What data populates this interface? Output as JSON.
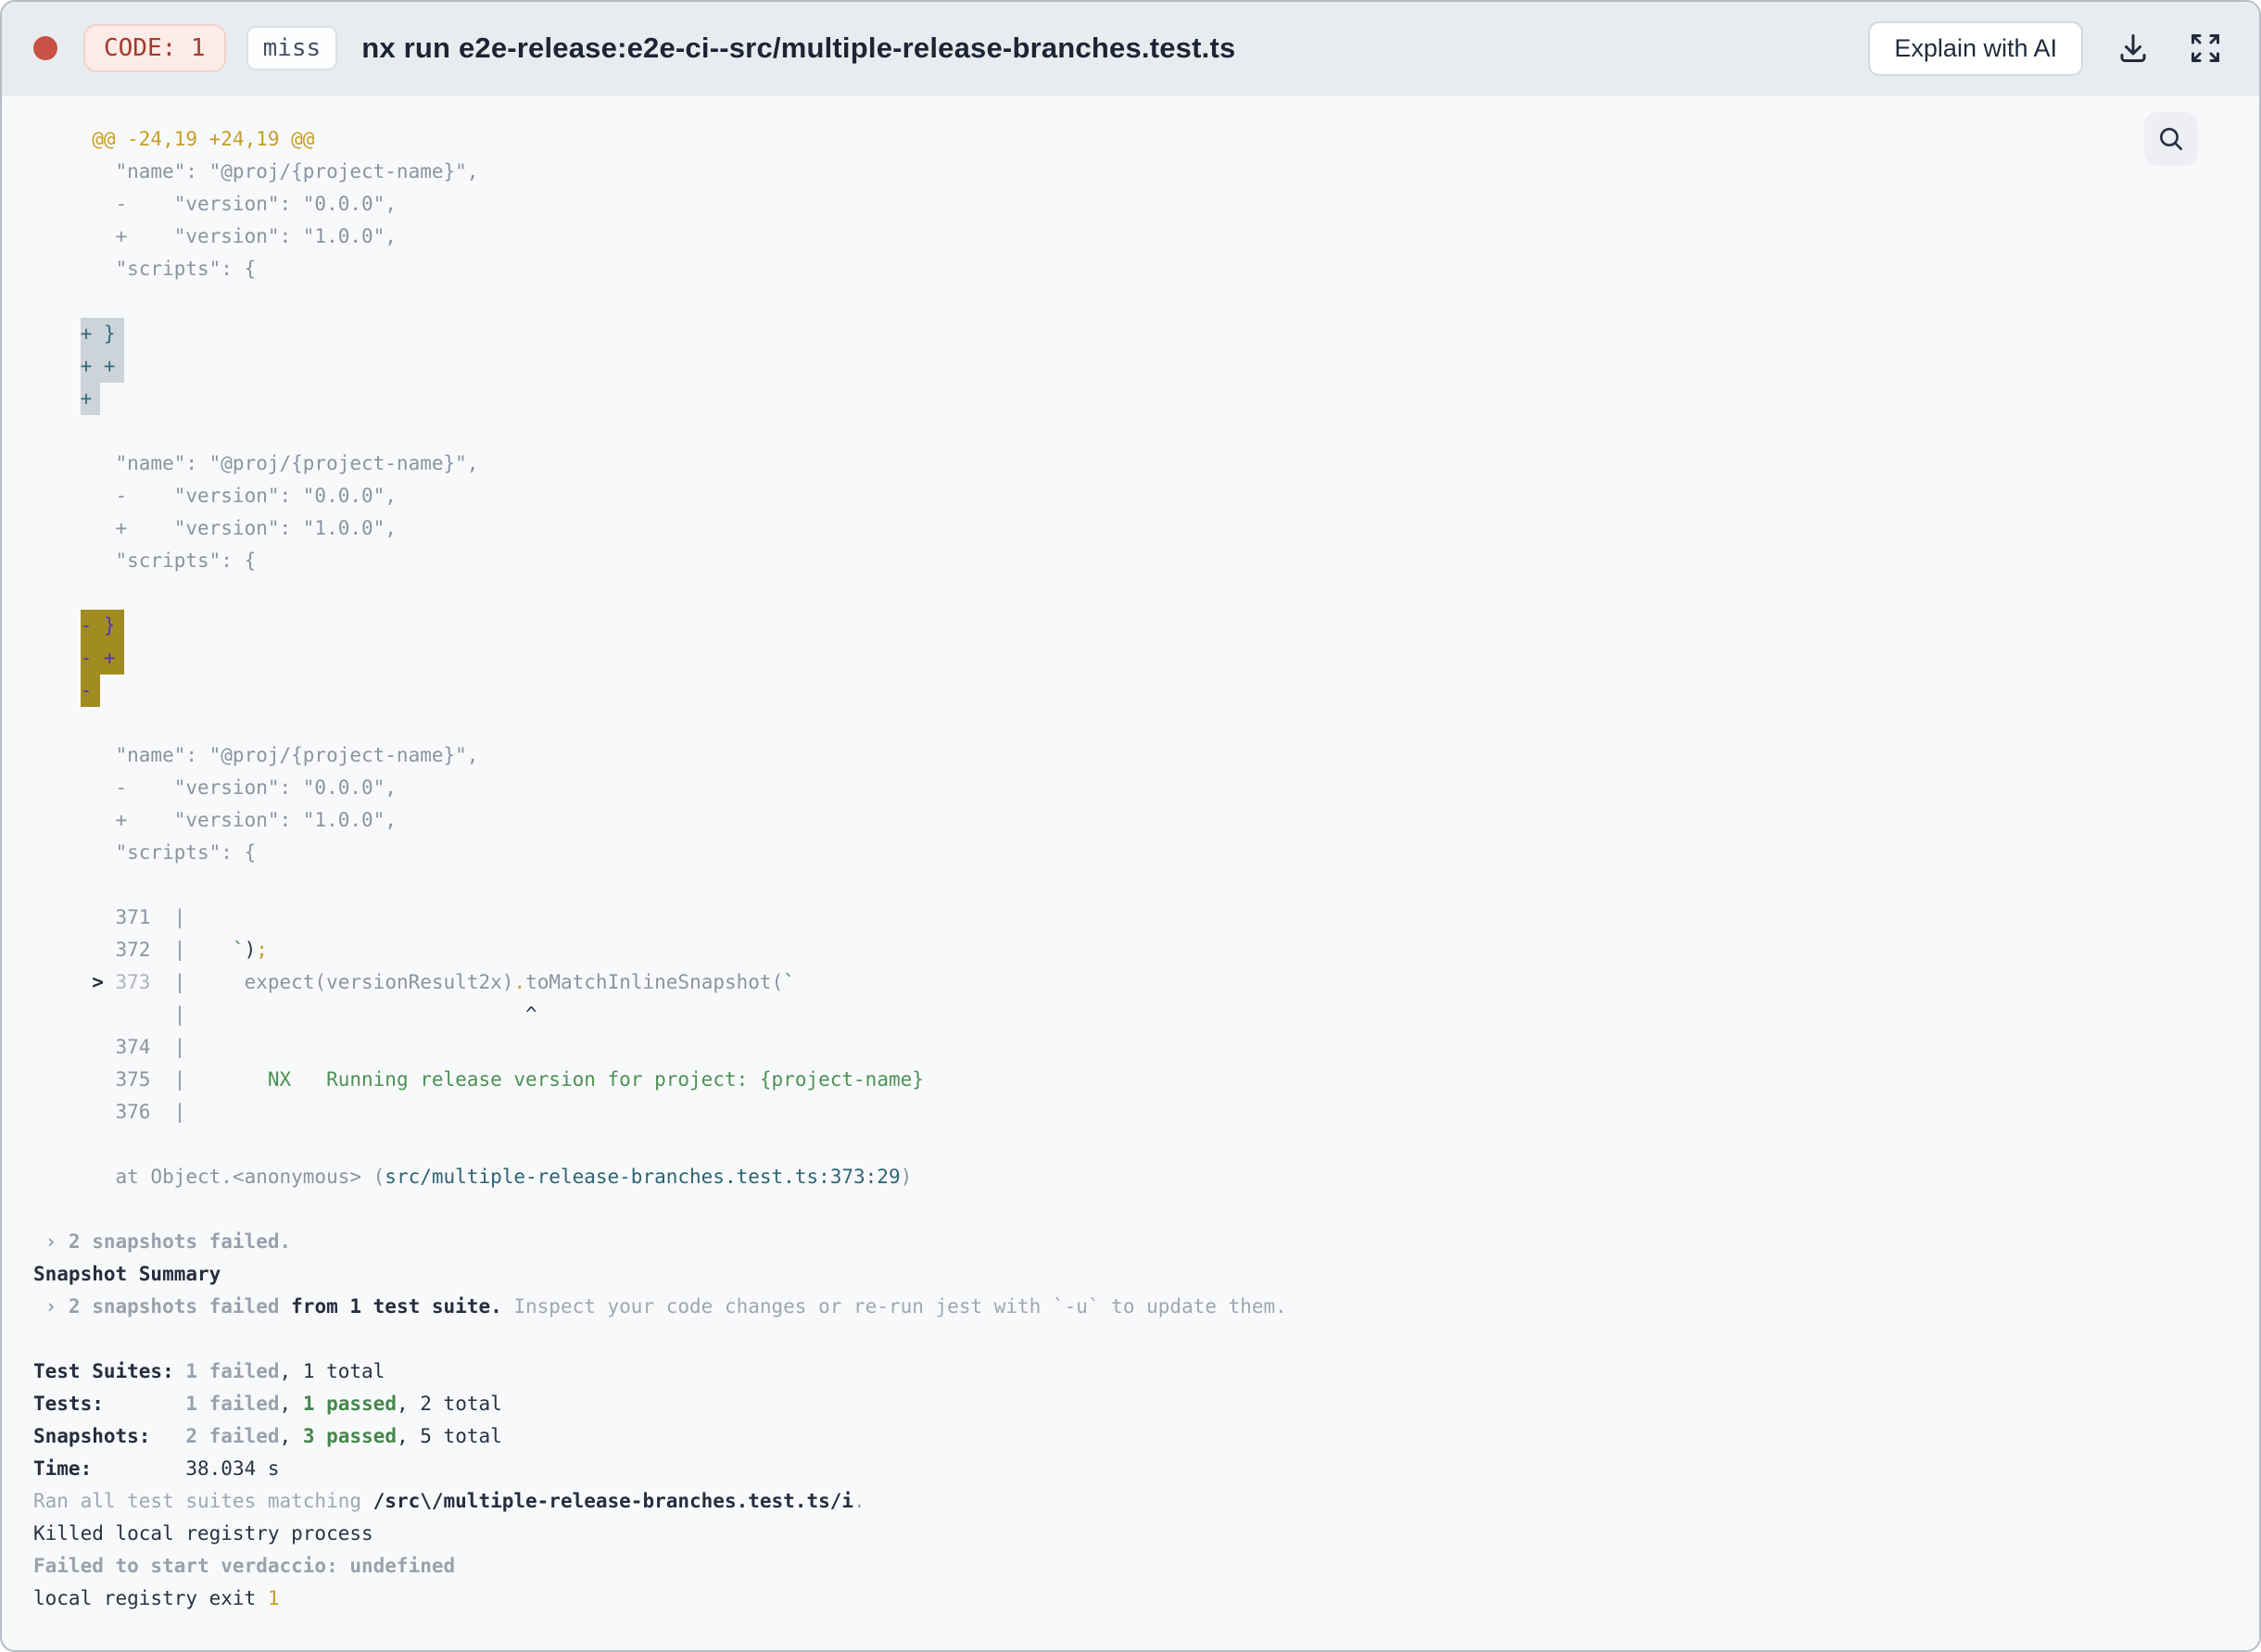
{
  "header": {
    "exit_code_badge": "CODE: 1",
    "cache_status_badge": "miss",
    "title": "nx run e2e-release:e2e-ci--src/multiple-release-branches.test.ts",
    "explain_ai_button": "Explain with AI",
    "icons": {
      "status_dot": "red-status-dot",
      "download_icon": "download-arrow-tray",
      "expand_icon": "fullscreen-corner-arrows",
      "search_icon": "magnifying-glass"
    }
  },
  "colors": {
    "header_bg": "#e8ecf1",
    "terminal_bg": "#f8f9fb",
    "status_red": "#c85045",
    "exit_badge_text": "#a23b2e",
    "exit_badge_bg": "#fcebe7",
    "hunk_yellow": "#c79e23",
    "diff_gray": "#8d939f",
    "success_green": "#4c9153",
    "file_link_teal": "#2d6473",
    "added_highlight_bg": "#ccd3d9",
    "added_highlight_text": "#336b79",
    "removed_highlight_bg": "#a18c20",
    "removed_highlight_text": "#5532b4"
  },
  "terminal": {
    "lines": [
      [
        {
          "t": "     @@ -24,19 +24,19 @@",
          "c": "yellow"
        }
      ],
      [
        {
          "t": "       \"name\": \"@proj/{project-name}\",",
          "c": "ctx"
        }
      ],
      [
        {
          "t": "       -    \"version\": \"0.0.0\",",
          "c": "ctx"
        }
      ],
      [
        {
          "t": "       +    \"version\": \"1.0.0\",",
          "c": "ctx"
        }
      ],
      [
        {
          "t": "       \"scripts\": {",
          "c": "ctx"
        }
      ],
      [],
      [
        {
          "t": "    ",
          "c": "ctx"
        },
        {
          "t": "+ }",
          "c": "add"
        }
      ],
      [
        {
          "t": "    ",
          "c": "ctx"
        },
        {
          "t": "+ +",
          "c": "add"
        }
      ],
      [
        {
          "t": "    ",
          "c": "ctx"
        },
        {
          "t": "+",
          "c": "add"
        }
      ],
      [],
      [
        {
          "t": "       \"name\": \"@proj/{project-name}\",",
          "c": "ctx"
        }
      ],
      [
        {
          "t": "       -    \"version\": \"0.0.0\",",
          "c": "ctx"
        }
      ],
      [
        {
          "t": "       +    \"version\": \"1.0.0\",",
          "c": "ctx"
        }
      ],
      [
        {
          "t": "       \"scripts\": {",
          "c": "ctx"
        }
      ],
      [],
      [
        {
          "t": "    ",
          "c": "ctx"
        },
        {
          "t": "- }",
          "c": "del"
        }
      ],
      [
        {
          "t": "    ",
          "c": "ctx"
        },
        {
          "t": "- +",
          "c": "del"
        }
      ],
      [
        {
          "t": "    ",
          "c": "ctx"
        },
        {
          "t": "-",
          "c": "del"
        }
      ],
      [],
      [
        {
          "t": "       \"name\": \"@proj/{project-name}\",",
          "c": "ctx"
        }
      ],
      [
        {
          "t": "       -    \"version\": \"0.0.0\",",
          "c": "ctx"
        }
      ],
      [
        {
          "t": "       +    \"version\": \"1.0.0\",",
          "c": "ctx"
        }
      ],
      [
        {
          "t": "       \"scripts\": {",
          "c": "ctx"
        }
      ],
      [],
      [
        {
          "t": "       371  |",
          "c": "ctx"
        }
      ],
      [
        {
          "t": "       372  |    ",
          "c": "ctx"
        },
        {
          "t": "`",
          "c": "green"
        },
        {
          "t": ")",
          "c": "dark"
        },
        {
          "t": ";",
          "c": "yellow"
        }
      ],
      [
        {
          "t": "     ",
          "c": "ctx"
        },
        {
          "t": "> ",
          "c": "marker"
        },
        {
          "t": "373",
          "c": "dim"
        },
        {
          "t": "  |",
          "c": "ctx"
        },
        {
          "t": "     expect(versionResult2x)",
          "c": "ctx"
        },
        {
          "t": ".",
          "c": "yellow"
        },
        {
          "t": "toMatchInlineSnapshot(",
          "c": "ctx"
        },
        {
          "t": "`",
          "c": "green"
        }
      ],
      [
        {
          "t": "            |",
          "c": "ctx"
        },
        {
          "t": "                             ",
          "c": "ctx"
        },
        {
          "t": "^",
          "c": "dark"
        }
      ],
      [
        {
          "t": "       374  |",
          "c": "ctx"
        }
      ],
      [
        {
          "t": "       375  |",
          "c": "ctx"
        },
        {
          "t": "       NX   Running release version for project: {project-name}",
          "c": "green"
        }
      ],
      [
        {
          "t": "       376  |",
          "c": "ctx"
        }
      ],
      [],
      [
        {
          "t": "       at Object.<anonymous> (",
          "c": "ctx"
        },
        {
          "t": "src/multiple-release-branches.test.ts:373:29",
          "c": "teal"
        },
        {
          "t": ")",
          "c": "ctx"
        }
      ],
      [],
      [
        {
          "t": " › 2 snapshots failed.",
          "c": "gray-bold"
        }
      ],
      [
        {
          "t": "Snapshot Summary",
          "c": "dark-bold"
        }
      ],
      [
        {
          "t": " › 2 snapshots failed",
          "c": "gray-bold"
        },
        {
          "t": " from 1 test suite.",
          "c": "dark-bold"
        },
        {
          "t": " Inspect your code changes or re-run jest with `-u` to update them.",
          "c": "gray"
        }
      ],
      [],
      [
        {
          "t": "Test Suites: ",
          "c": "dark-bold"
        },
        {
          "t": "1 failed",
          "c": "gray-bold"
        },
        {
          "t": ", 1 total",
          "c": "dark"
        }
      ],
      [
        {
          "t": "Tests:       ",
          "c": "dark-bold"
        },
        {
          "t": "1 failed",
          "c": "gray-bold"
        },
        {
          "t": ", ",
          "c": "dark"
        },
        {
          "t": "1 passed",
          "c": "green-bold"
        },
        {
          "t": ", 2 total",
          "c": "dark"
        }
      ],
      [
        {
          "t": "Snapshots:   ",
          "c": "dark-bold"
        },
        {
          "t": "2 failed",
          "c": "gray-bold"
        },
        {
          "t": ", ",
          "c": "dark"
        },
        {
          "t": "3 passed",
          "c": "green-bold"
        },
        {
          "t": ", 5 total",
          "c": "dark"
        }
      ],
      [
        {
          "t": "Time:        ",
          "c": "dark-bold"
        },
        {
          "t": "38.034 s",
          "c": "dark"
        }
      ],
      [
        {
          "t": "Ran all test suites matching ",
          "c": "gray"
        },
        {
          "t": "/src\\/multiple-release-branches.test.ts/i",
          "c": "dark-bold"
        },
        {
          "t": ".",
          "c": "gray"
        }
      ],
      [
        {
          "t": "Killed local registry process",
          "c": "dark"
        }
      ],
      [
        {
          "t": "Failed to start verdaccio: undefined",
          "c": "gray-bold"
        }
      ],
      [
        {
          "t": "local registry exit ",
          "c": "dark"
        },
        {
          "t": "1",
          "c": "yellow"
        }
      ]
    ]
  }
}
